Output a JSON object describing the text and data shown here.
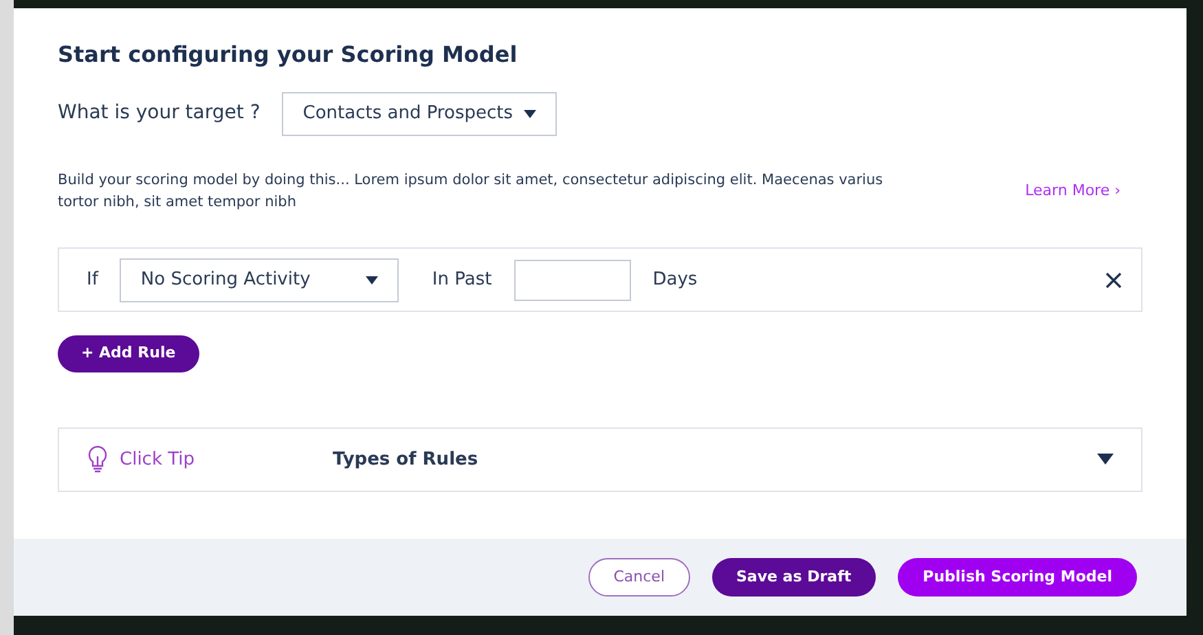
{
  "title": "Start configuring your Scoring Model",
  "target": {
    "label": "What is your target ?",
    "value": "Contacts and Prospects"
  },
  "description": "Build your scoring model by doing this... Lorem ipsum dolor sit amet, consectetur adipiscing elit. Maecenas varius tortor nibh, sit amet tempor nibh",
  "learn_more": "Learn More ›",
  "rules": [
    {
      "if_label": "If",
      "activity": "No Scoring Activity",
      "past_label": "In Past",
      "days_label": "Days"
    }
  ],
  "add_rule": "+ Add Rule",
  "tip": {
    "label": "Click Tip",
    "title": "Types of Rules",
    "expanded": false
  },
  "buttons": [
    {
      "label": "Cancel",
      "kind": "outline"
    },
    {
      "label": "Save as Draft",
      "kind": "dark"
    },
    {
      "label": "Publish Scoring Model",
      "kind": "primary"
    }
  ]
}
